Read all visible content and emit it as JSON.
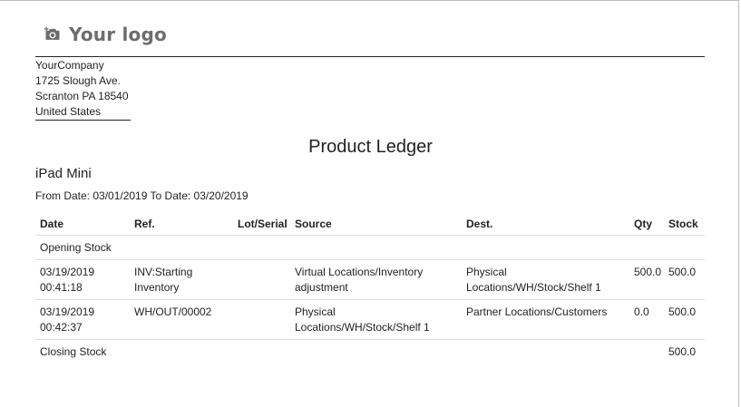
{
  "logo": {
    "text": "Your logo",
    "icon": "camera-icon"
  },
  "company": {
    "name": "YourCompany",
    "street": "1725 Slough Ave.",
    "city": "Scranton PA 18540",
    "country": "United States"
  },
  "report": {
    "title": "Product Ledger",
    "product": "iPad Mini",
    "date_range": "From Date: 03/01/2019 To Date: 03/20/2019"
  },
  "table": {
    "headers": {
      "date": "Date",
      "ref": "Ref.",
      "lot": "Lot/Serial",
      "source": "Source",
      "dest": "Dest.",
      "qty": "Qty",
      "stock": "Stock"
    },
    "opening_label": "Opening Stock",
    "rows": [
      {
        "date": "03/19/2019",
        "time": "00:41:18",
        "ref1": "INV:Starting",
        "ref2": "Inventory",
        "lot": "",
        "source1": "Virtual Locations/Inventory",
        "source2": "adjustment",
        "dest1": "Physical",
        "dest2": "Locations/WH/Stock/Shelf 1",
        "qty": "500.0",
        "stock": "500.0"
      },
      {
        "date": "03/19/2019",
        "time": "00:42:37",
        "ref1": "WH/OUT/00002",
        "ref2": "",
        "lot": "",
        "source1": "Physical",
        "source2": "Locations/WH/Stock/Shelf 1",
        "dest1": "Partner Locations/Customers",
        "dest2": "",
        "qty": "0.0",
        "stock": "500.0"
      }
    ],
    "closing_label": "Closing Stock",
    "closing_stock": "500.0"
  }
}
